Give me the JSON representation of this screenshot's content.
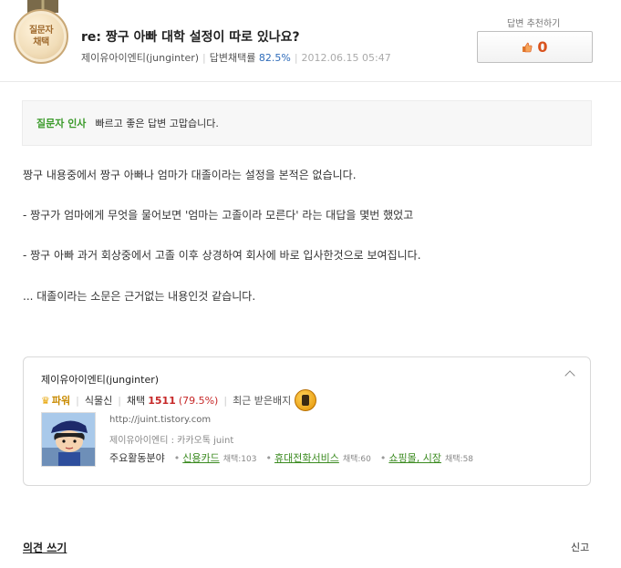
{
  "medal": {
    "line1": "질문자",
    "line2": "채택"
  },
  "answer": {
    "title": "re: 짱구 아빠 대학 설정이 따로 있나요?",
    "author": "제이유아이엔티(junginter)",
    "adopt_label": "답변채택률",
    "adopt_rate": "82.5%",
    "date": "2012.06.15 05:47"
  },
  "recommend": {
    "label": "답변 추천하기",
    "count": "0"
  },
  "greeting": {
    "label": "질문자 인사",
    "text": "빠르고 좋은 답변 고맙습니다."
  },
  "body": [
    "짱구 내용중에서 짱구 아빠나 엄마가 대졸이라는 설정을 본적은 없습니다.",
    "- 짱구가 엄마에게 무엇을 물어보면 '엄마는 고졸이라 모른다' 라는 대답을 몇번 했었고",
    "- 짱구 아빠 과거 회상중에서 고졸 이후 상경하여 회사에 바로 입사한것으로 보여집니다.",
    "... 대졸이라는 소문은 근거없는 내용인것 같습니다."
  ],
  "profile": {
    "name": "제이유아이엔티(junginter)",
    "level": "파워",
    "grade": "식물신",
    "adopt_label": "채택",
    "adopt_count": "1511",
    "adopt_pct": "(79.5%)",
    "badge_label": "최근 받은배지",
    "blog": "http://juint.tistory.com",
    "kakao": "제이유아이엔티 : 카카오톡 juint",
    "fields_label": "주요활동분야",
    "fields": [
      {
        "name": "신용카드",
        "count": "채택:103"
      },
      {
        "name": "휴대전화서비스",
        "count": "채택:60"
      },
      {
        "name": "쇼핑몰, 시장",
        "count": "채택:58"
      }
    ]
  },
  "footer": {
    "opinion": "의견 쓰기",
    "report": "신고"
  }
}
